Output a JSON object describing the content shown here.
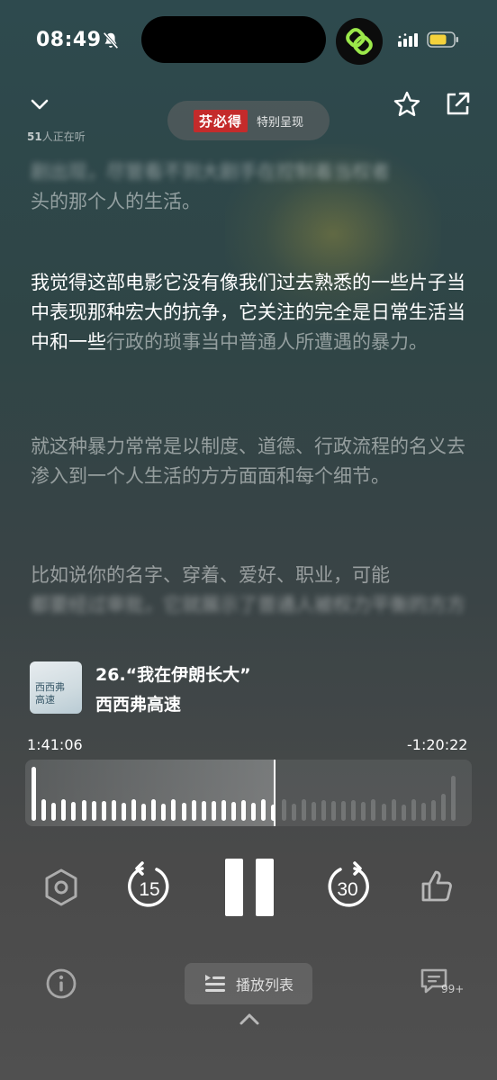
{
  "status_bar": {
    "time": "08:49"
  },
  "header": {
    "listeners_count": "51",
    "listeners_suffix": "人正在听",
    "brand_logo": "芬必得",
    "brand_label": "特别呈现"
  },
  "transcript": [
    {
      "text": "剧出现，尽管看不到大剧手在控制着当权者头的那个人的生活。",
      "lead": "头的那个人的生活。",
      "state": "blur"
    },
    {
      "text_bright": "我觉得这部电影它没有像我们过去熟悉的一些片子当中表现那种宏大的抗争，它关注的完全是日常生活当中和一些",
      "text_dim": "行政的琐事当中普通人所遭遇的暴力。",
      "state": "active"
    },
    {
      "text": "就这种暴力常常是以制度、道德、行政流程的名义去渗入到一个人生活的方方面面和每个细节。",
      "state": "dim"
    },
    {
      "text": "比如说你的名字、穿着、爱好、职业，可能",
      "tail": "都要经过审批，它就展示了普通人被权力平衡的方方面面，这些不能被控制的",
      "state": "dim"
    }
  ],
  "now_playing": {
    "cover_line1": "西西弗",
    "cover_line2": "高速",
    "episode_title": "26.“我在伊朗长大”",
    "show_name": "西西弗高速"
  },
  "progress": {
    "elapsed": "1:41:06",
    "remaining": "-1:20:22",
    "played_fraction": 0.556
  },
  "controls": {
    "rewind_seconds": "15",
    "forward_seconds": "30"
  },
  "bottom": {
    "playlist_label": "播放列表",
    "comment_count": "99+"
  }
}
